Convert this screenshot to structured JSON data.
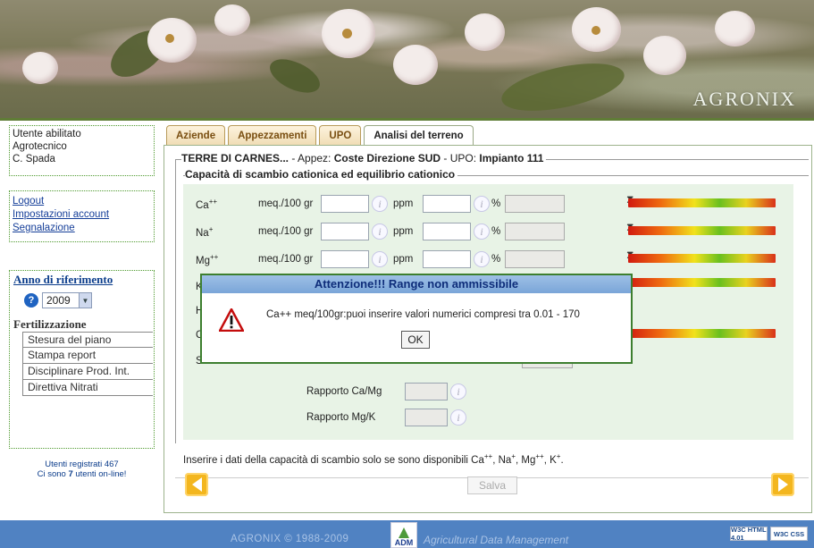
{
  "header": {
    "brand": "AGRONIX"
  },
  "sidebar": {
    "user": {
      "line1": "Utente abilitato",
      "line2": "Agrotecnico",
      "line3": "C. Spada"
    },
    "links": [
      "Logout",
      "Impostazioni account",
      "Segnalazione"
    ],
    "year_title": "Anno di riferimento",
    "help_icon_glyph": "?",
    "year_value": "2009",
    "fert_title": "Fertilizzazione",
    "fert_items": [
      "Stesura del piano",
      "Stampa report",
      "Disciplinare Prod. Int.",
      "Direttiva Nitrati"
    ],
    "online": {
      "registered_prefix": "Utenti registrati",
      "registered_count": "467",
      "online_prefix": "Ci sono",
      "online_count": "7",
      "online_suffix": "utenti on-line!"
    }
  },
  "tabs": [
    "Aziende",
    "Appezzamenti",
    "UPO",
    "Analisi del terreno"
  ],
  "breadcrumb": {
    "company": "TERRE DI CARNES...",
    "sep1": " - Appez: ",
    "field": "Coste Direzione SUD",
    "sep2": " - UPO: ",
    "upo": "Impianto 111"
  },
  "section_title": "Capacità di scambio cationica ed equilibrio cationico",
  "cations": [
    {
      "base": "Ca",
      "sup": "++",
      "unit1": "meq./100 gr",
      "unit2": "ppm",
      "pct": "%"
    },
    {
      "base": "Na",
      "sup": "+",
      "unit1": "meq./100 gr",
      "unit2": "ppm",
      "pct": "%"
    },
    {
      "base": "Mg",
      "sup": "++",
      "unit1": "meq./100 gr",
      "unit2": "ppm",
      "pct": "%"
    },
    {
      "base": "K",
      "sup": "",
      "unit1": "",
      "unit2": "",
      "pct": ""
    },
    {
      "base": "H",
      "sup": "",
      "unit1": "",
      "unit2": "",
      "pct": ""
    },
    {
      "base": "C",
      "sup": "",
      "unit1": "",
      "unit2": "",
      "pct": ""
    },
    {
      "base": "S",
      "sup": "",
      "unit1": "",
      "unit2": "",
      "pct": ""
    }
  ],
  "info_glyph": "i",
  "marker_glyph": "⧗",
  "ratios": [
    "Rapporto Ca/Mg",
    "Rapporto Mg/K"
  ],
  "note": {
    "text": "Inserire i dati della capacità di scambio solo se sono disponibili Ca",
    "sup1": "++",
    "sep1": ", Na",
    "sup2": "+",
    "sep2": ", Mg",
    "sup3": "++",
    "sep3": ", K",
    "sup4": "+",
    "end": "."
  },
  "save_label": "Salva",
  "dialog": {
    "title": "Attenzione!!! Range non ammissibile",
    "message": "Ca++ meq/100gr:puoi inserire valori numerici compresi tra 0.01 - 170",
    "ok_label": "OK"
  },
  "footer": {
    "copyright": "AGRONIX   © 1988-2009",
    "logo_text": "ADM",
    "tagline": "Agricultural Data Management",
    "badge_html": "W3C HTML 4.01",
    "badge_css": "W3C CSS"
  },
  "colors": {
    "accent_green": "#3d7f2f",
    "footer_blue": "#5082c2",
    "tab_text": "#7a4f12"
  }
}
